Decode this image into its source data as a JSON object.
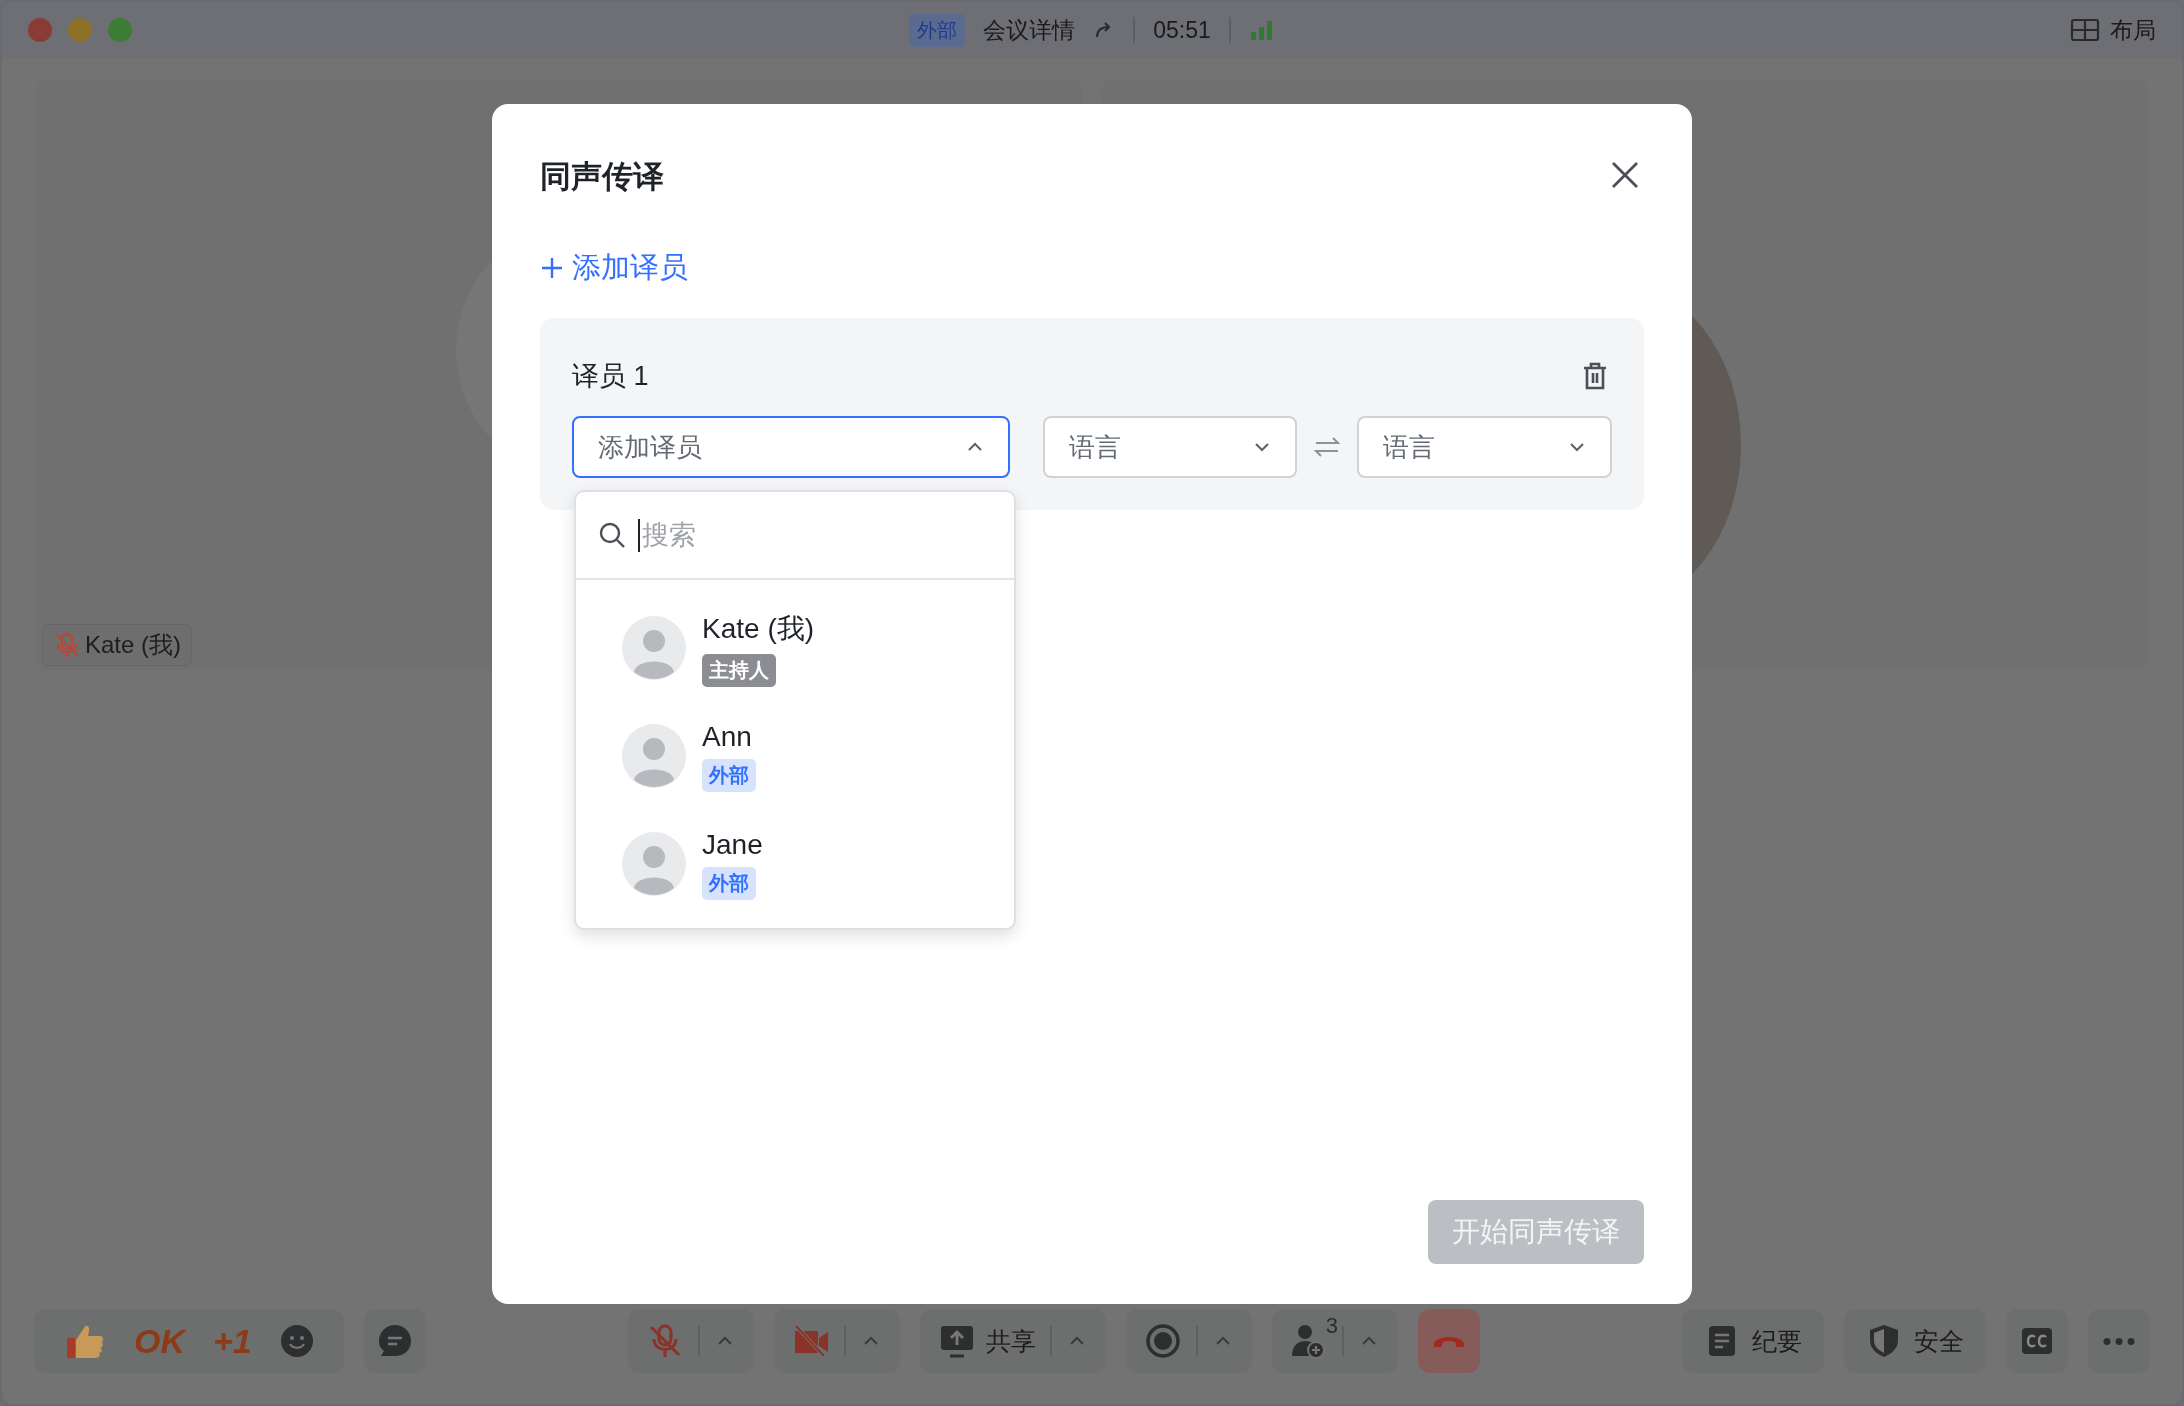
{
  "title_bar": {
    "tag": "外部",
    "title": "会议详情",
    "time": "05:51",
    "layout_label": "布局"
  },
  "video_tiles": [
    {
      "name": "Kate (我)",
      "muted": true
    }
  ],
  "toolbar": {
    "reactions": [
      {
        "kind": "thumb"
      },
      {
        "kind": "text",
        "label": "OK"
      },
      {
        "kind": "text",
        "label": "+1"
      },
      {
        "kind": "smiley"
      }
    ],
    "center": [
      {
        "kind": "mic-off",
        "menu": true
      },
      {
        "kind": "camera-off",
        "menu": true
      },
      {
        "kind": "share",
        "label": "共享",
        "menu": true
      },
      {
        "kind": "record",
        "menu": true
      },
      {
        "kind": "participants",
        "count": "3",
        "menu": true
      },
      {
        "kind": "hangup",
        "menu": false
      }
    ],
    "right": [
      {
        "kind": "notes",
        "label": "纪要"
      },
      {
        "kind": "security",
        "label": "安全"
      },
      {
        "kind": "captions"
      },
      {
        "kind": "more"
      }
    ]
  },
  "dialog": {
    "title": "同声传译",
    "add_link": "添加译员",
    "interpreters": [
      {
        "title": "译员 1",
        "person_select": {
          "placeholder": "添加译员",
          "expanded": true
        },
        "source_language": {
          "placeholder": "语言"
        },
        "target_language": {
          "placeholder": "语言"
        }
      }
    ],
    "dropdown": {
      "search_placeholder": "搜索",
      "options": [
        {
          "name": "Kate (我)",
          "tag": "主持人",
          "kind": "host"
        },
        {
          "name": "Ann",
          "tag": "外部",
          "kind": "external"
        },
        {
          "name": "Jane",
          "tag": "外部",
          "kind": "external"
        }
      ]
    },
    "start_button": {
      "label": "开始同声传译",
      "disabled": true
    }
  }
}
